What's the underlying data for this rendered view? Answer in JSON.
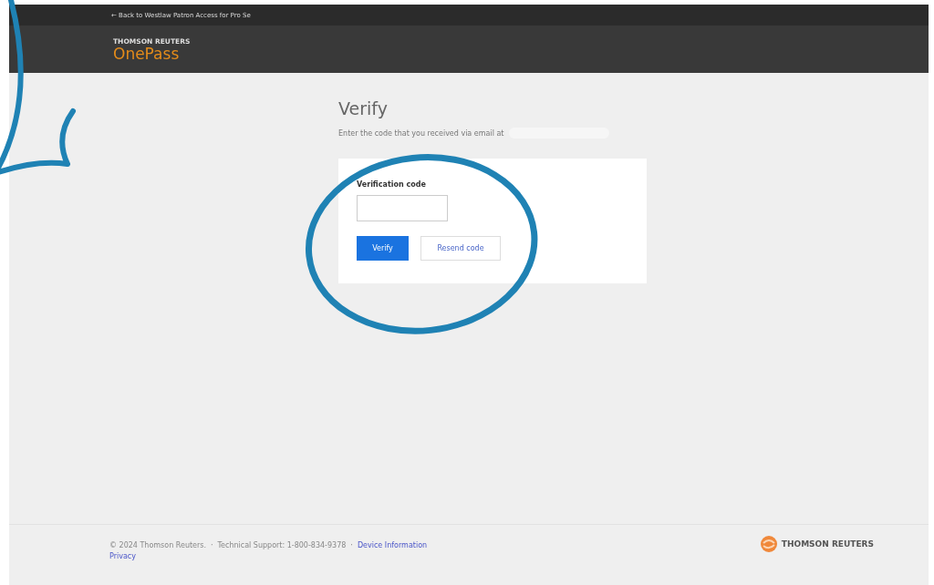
{
  "topbar": {
    "back_link": "← Back to Westlaw Patron Access for Pro Se"
  },
  "brand": {
    "company": "THOMSON REUTERS",
    "product": "OnePass"
  },
  "main": {
    "title": "Verify",
    "instruction": "Enter the code that you received via email at",
    "email_redacted": true
  },
  "form": {
    "label": "Verification code",
    "verify_button": "Verify",
    "resend_button": "Resend code"
  },
  "footer": {
    "copyright": "© 2024 Thomson Reuters.",
    "separators": [
      "·",
      "·"
    ],
    "support": "Technical Support: 1-800-834-9378",
    "device_link": "Device Information",
    "privacy_link": "Privacy",
    "logo_text": "THOMSON REUTERS"
  }
}
